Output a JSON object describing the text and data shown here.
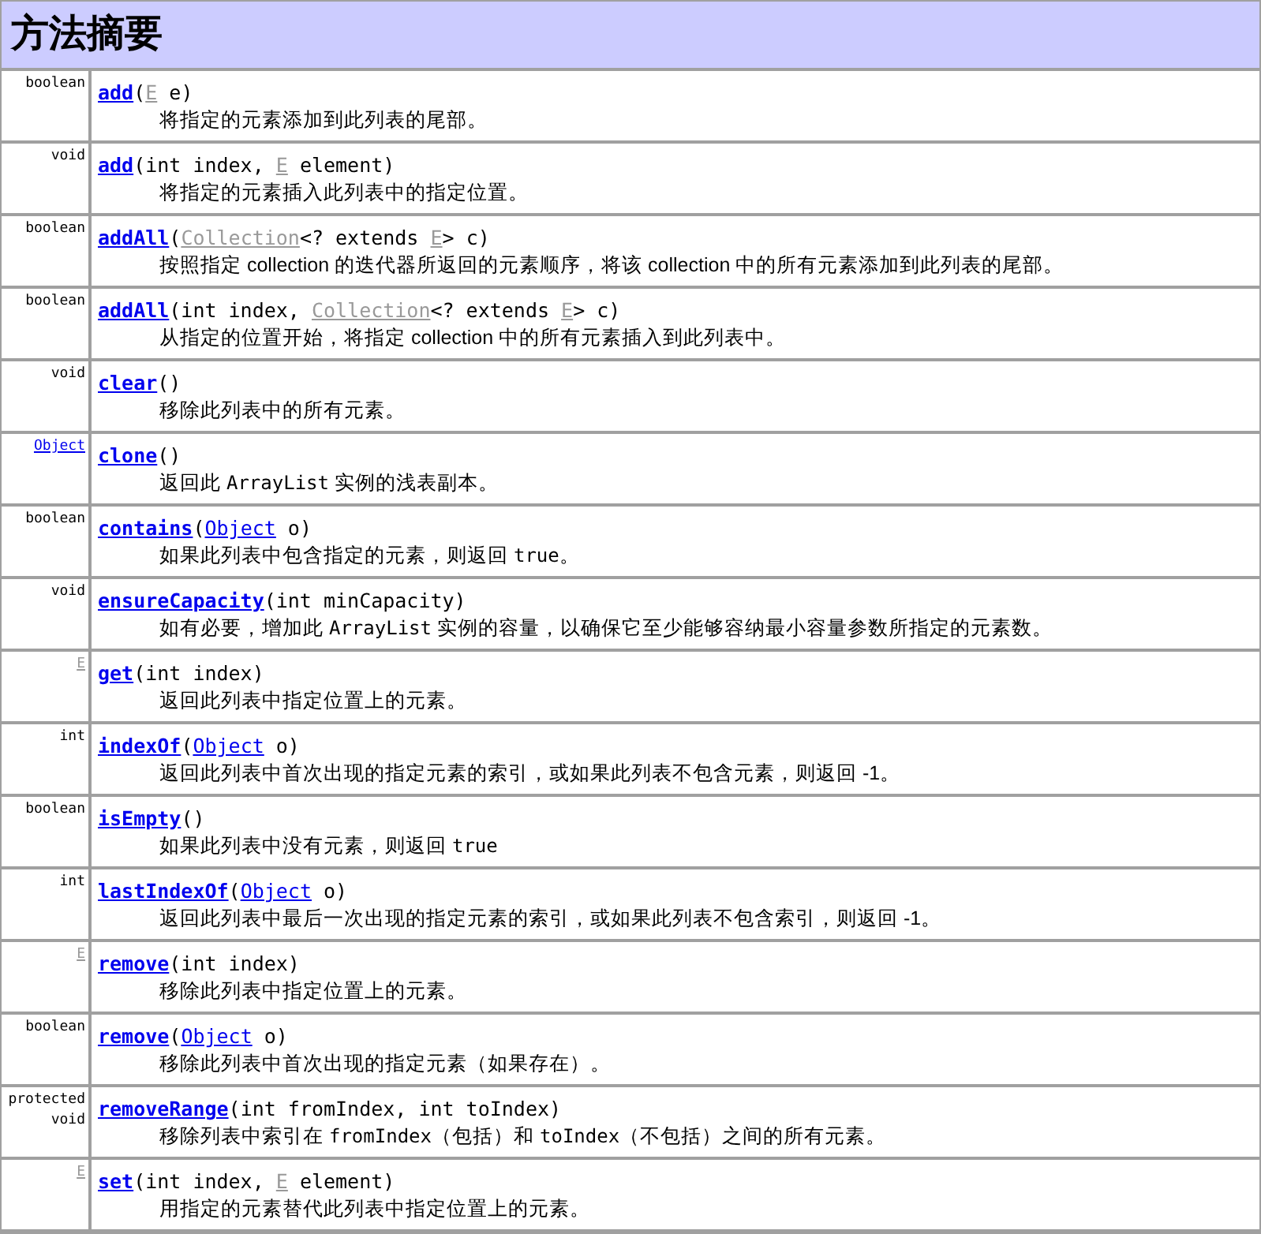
{
  "title": "方法摘要",
  "methods": [
    {
      "returns": {
        "kind": "text",
        "text": "boolean"
      },
      "signature": [
        {
          "kind": "method",
          "text": "add"
        },
        {
          "kind": "text",
          "text": "("
        },
        {
          "kind": "param",
          "text": "E"
        },
        {
          "kind": "text",
          "text": " e)"
        }
      ],
      "description": [
        {
          "kind": "text",
          "text": "将指定的元素添加到此列表的尾部。"
        }
      ]
    },
    {
      "returns": {
        "kind": "text",
        "text": "void"
      },
      "signature": [
        {
          "kind": "method",
          "text": "add"
        },
        {
          "kind": "text",
          "text": "(int index, "
        },
        {
          "kind": "param",
          "text": "E"
        },
        {
          "kind": "text",
          "text": " element)"
        }
      ],
      "description": [
        {
          "kind": "text",
          "text": "将指定的元素插入此列表中的指定位置。"
        }
      ]
    },
    {
      "returns": {
        "kind": "text",
        "text": "boolean"
      },
      "signature": [
        {
          "kind": "method",
          "text": "addAll"
        },
        {
          "kind": "text",
          "text": "("
        },
        {
          "kind": "param",
          "text": "Collection"
        },
        {
          "kind": "text",
          "text": "<? extends "
        },
        {
          "kind": "param",
          "text": "E"
        },
        {
          "kind": "text",
          "text": "> c)"
        }
      ],
      "description": [
        {
          "kind": "text",
          "text": "按照指定 collection 的迭代器所返回的元素顺序，将该 collection 中的所有元素添加到此列表的尾部。"
        }
      ]
    },
    {
      "returns": {
        "kind": "text",
        "text": "boolean"
      },
      "signature": [
        {
          "kind": "method",
          "text": "addAll"
        },
        {
          "kind": "text",
          "text": "(int index, "
        },
        {
          "kind": "param",
          "text": "Collection"
        },
        {
          "kind": "text",
          "text": "<? extends "
        },
        {
          "kind": "param",
          "text": "E"
        },
        {
          "kind": "text",
          "text": "> c)"
        }
      ],
      "description": [
        {
          "kind": "text",
          "text": "从指定的位置开始，将指定 collection 中的所有元素插入到此列表中。"
        }
      ]
    },
    {
      "returns": {
        "kind": "text",
        "text": "void"
      },
      "signature": [
        {
          "kind": "method",
          "text": "clear"
        },
        {
          "kind": "text",
          "text": "()"
        }
      ],
      "description": [
        {
          "kind": "text",
          "text": "移除此列表中的所有元素。"
        }
      ]
    },
    {
      "returns": {
        "kind": "link",
        "text": "Object"
      },
      "signature": [
        {
          "kind": "method",
          "text": "clone"
        },
        {
          "kind": "text",
          "text": "()"
        }
      ],
      "description": [
        {
          "kind": "text",
          "text": "返回此 "
        },
        {
          "kind": "code",
          "text": "ArrayList"
        },
        {
          "kind": "text",
          "text": " 实例的浅表副本。"
        }
      ]
    },
    {
      "returns": {
        "kind": "text",
        "text": "boolean"
      },
      "signature": [
        {
          "kind": "method",
          "text": "contains"
        },
        {
          "kind": "text",
          "text": "("
        },
        {
          "kind": "link",
          "text": "Object"
        },
        {
          "kind": "text",
          "text": " o)"
        }
      ],
      "description": [
        {
          "kind": "text",
          "text": "如果此列表中包含指定的元素，则返回 "
        },
        {
          "kind": "code",
          "text": "true"
        },
        {
          "kind": "text",
          "text": "。"
        }
      ]
    },
    {
      "returns": {
        "kind": "text",
        "text": "void"
      },
      "signature": [
        {
          "kind": "method",
          "text": "ensureCapacity"
        },
        {
          "kind": "text",
          "text": "(int minCapacity)"
        }
      ],
      "description": [
        {
          "kind": "text",
          "text": "如有必要，增加此 "
        },
        {
          "kind": "code",
          "text": "ArrayList"
        },
        {
          "kind": "text",
          "text": " 实例的容量，以确保它至少能够容纳最小容量参数所指定的元素数。"
        }
      ]
    },
    {
      "returns": {
        "kind": "param",
        "text": "E"
      },
      "signature": [
        {
          "kind": "method",
          "text": "get"
        },
        {
          "kind": "text",
          "text": "(int index)"
        }
      ],
      "description": [
        {
          "kind": "text",
          "text": "返回此列表中指定位置上的元素。"
        }
      ]
    },
    {
      "returns": {
        "kind": "text",
        "text": "int"
      },
      "signature": [
        {
          "kind": "method",
          "text": "indexOf"
        },
        {
          "kind": "text",
          "text": "("
        },
        {
          "kind": "link",
          "text": "Object"
        },
        {
          "kind": "text",
          "text": " o)"
        }
      ],
      "description": [
        {
          "kind": "text",
          "text": "返回此列表中首次出现的指定元素的索引，或如果此列表不包含元素，则返回 -1。"
        }
      ]
    },
    {
      "returns": {
        "kind": "text",
        "text": "boolean"
      },
      "signature": [
        {
          "kind": "method",
          "text": "isEmpty"
        },
        {
          "kind": "text",
          "text": "()"
        }
      ],
      "description": [
        {
          "kind": "text",
          "text": "如果此列表中没有元素，则返回 "
        },
        {
          "kind": "code",
          "text": "true"
        }
      ]
    },
    {
      "returns": {
        "kind": "text",
        "text": "int"
      },
      "signature": [
        {
          "kind": "method",
          "text": "lastIndexOf"
        },
        {
          "kind": "text",
          "text": "("
        },
        {
          "kind": "link",
          "text": "Object"
        },
        {
          "kind": "text",
          "text": " o)"
        }
      ],
      "description": [
        {
          "kind": "text",
          "text": "返回此列表中最后一次出现的指定元素的索引，或如果此列表不包含索引，则返回 -1。"
        }
      ]
    },
    {
      "returns": {
        "kind": "param",
        "text": "E"
      },
      "signature": [
        {
          "kind": "method",
          "text": "remove"
        },
        {
          "kind": "text",
          "text": "(int index)"
        }
      ],
      "description": [
        {
          "kind": "text",
          "text": "移除此列表中指定位置上的元素。"
        }
      ]
    },
    {
      "returns": {
        "kind": "text",
        "text": "boolean"
      },
      "signature": [
        {
          "kind": "method",
          "text": "remove"
        },
        {
          "kind": "text",
          "text": "("
        },
        {
          "kind": "link",
          "text": "Object"
        },
        {
          "kind": "text",
          "text": " o)"
        }
      ],
      "description": [
        {
          "kind": "text",
          "text": "移除此列表中首次出现的指定元素（如果存在）。"
        }
      ]
    },
    {
      "returns": {
        "kind": "text",
        "text": "protected void"
      },
      "signature": [
        {
          "kind": "method",
          "text": "removeRange"
        },
        {
          "kind": "text",
          "text": "(int fromIndex, int toIndex)"
        }
      ],
      "description": [
        {
          "kind": "text",
          "text": "移除列表中索引在 "
        },
        {
          "kind": "code",
          "text": "fromIndex"
        },
        {
          "kind": "text",
          "text": "（包括）和 "
        },
        {
          "kind": "code",
          "text": "toIndex"
        },
        {
          "kind": "text",
          "text": "（不包括）之间的所有元素。"
        }
      ]
    },
    {
      "returns": {
        "kind": "param",
        "text": "E"
      },
      "signature": [
        {
          "kind": "method",
          "text": "set"
        },
        {
          "kind": "text",
          "text": "(int index, "
        },
        {
          "kind": "param",
          "text": "E"
        },
        {
          "kind": "text",
          "text": " element)"
        }
      ],
      "description": [
        {
          "kind": "text",
          "text": "用指定的元素替代此列表中指定位置上的元素。"
        }
      ]
    }
  ]
}
